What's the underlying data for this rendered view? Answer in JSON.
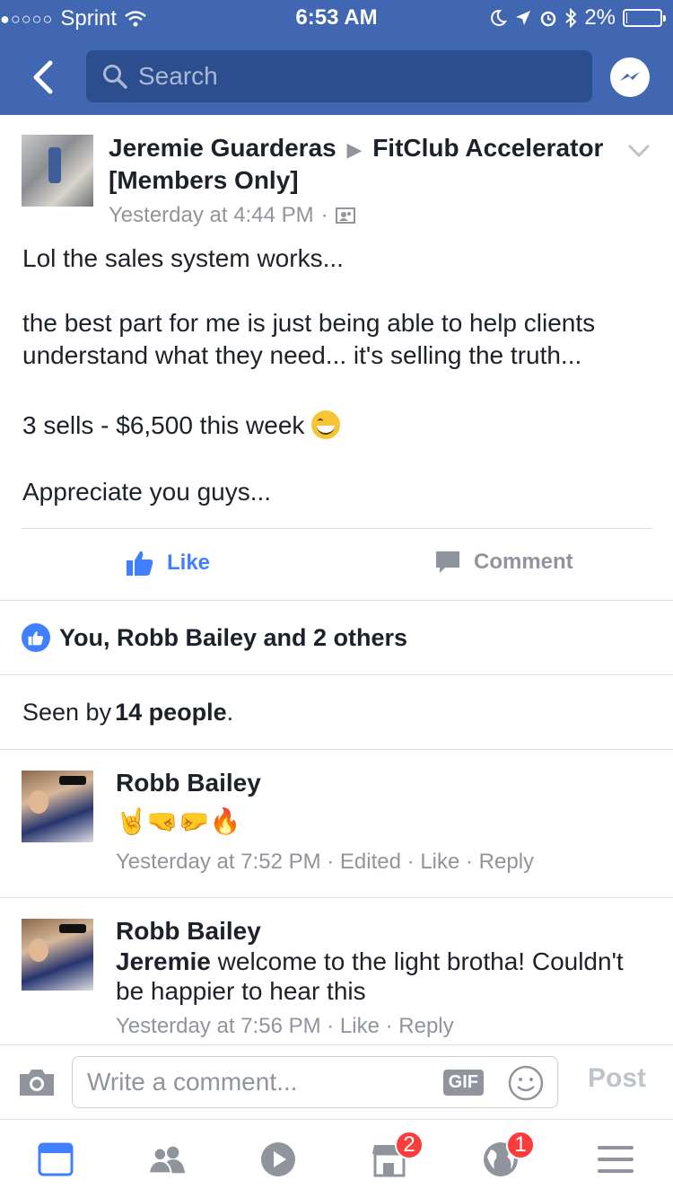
{
  "status_bar": {
    "carrier": "Sprint",
    "time": "6:53 AM",
    "battery": "2%",
    "battery_level": 0.02
  },
  "nav": {
    "search_placeholder": "Search"
  },
  "post": {
    "author": "Jeremie Guarderas",
    "group": "FitClub Accelerator [Members Only]",
    "timestamp": "Yesterday at 4:44 PM",
    "separator": "·",
    "body": {
      "line1": "Lol the sales system works...",
      "line2": "the best part for me is just being able to help clients understand what they need... it's selling the truth...",
      "line3": "3 sells - $6,500 this week",
      "line4": "Appreciate you guys..."
    },
    "actions": {
      "like": "Like",
      "comment": "Comment"
    },
    "likes_summary": "You, Robb Bailey and 2 others",
    "seen": {
      "prefix": "Seen by",
      "count": "14 people",
      "suffix": "."
    }
  },
  "comments": [
    {
      "name": "Robb Bailey",
      "emojis": "🤘🤜🤛🔥",
      "time": "Yesterday at 7:52 PM",
      "edited": "Edited",
      "like": "Like",
      "reply": "Reply"
    },
    {
      "name": "Robb Bailey",
      "mention": "Jeremie",
      "text": "welcome to the light brotha! Couldn't be happier to hear this",
      "time": "Yesterday at 7:56 PM",
      "like": "Like",
      "reply": "Reply"
    }
  ],
  "composer": {
    "placeholder": "Write a comment...",
    "gif": "GIF",
    "post": "Post"
  },
  "tabbar": {
    "marketplace_badge": "2",
    "notifications_badge": "1"
  },
  "colors": {
    "brand": "#4267b2",
    "link_blue": "#4080ff",
    "muted": "#90949c",
    "badge_red": "#fa3e3e"
  }
}
